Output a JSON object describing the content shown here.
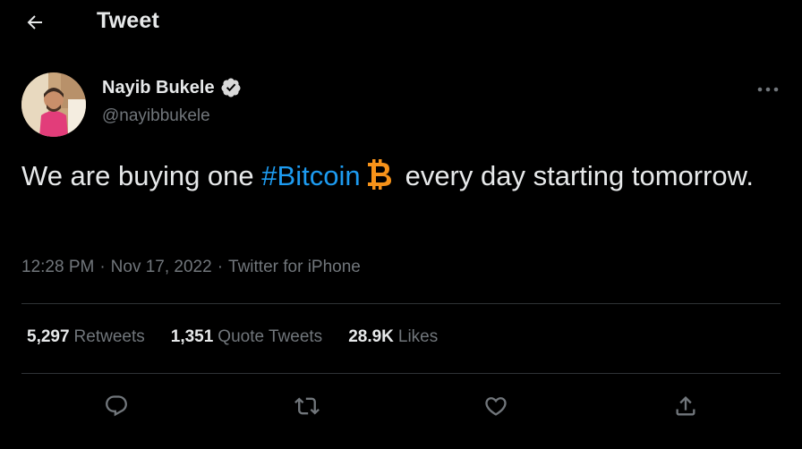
{
  "header": {
    "title": "Tweet",
    "back_icon": "arrow-left-icon"
  },
  "author": {
    "display_name": "Nayib Bukele",
    "handle": "@nayibbukele",
    "verified_icon": "verified-badge-icon",
    "avatar_icon": "avatar"
  },
  "tweet": {
    "text_before": "We are buying one ",
    "hashtag": "#Bitcoin",
    "emoji": "bitcoin-emoji-icon",
    "text_after": "every day starting tomorrow."
  },
  "meta": {
    "time": "12:28 PM",
    "separator": "·",
    "date": "Nov 17, 2022",
    "source": "Twitter for iPhone"
  },
  "stats": [
    {
      "count": "5,297",
      "label": "Retweets"
    },
    {
      "count": "1,351",
      "label": "Quote Tweets"
    },
    {
      "count": "28.9K",
      "label": "Likes"
    }
  ],
  "actions": [
    {
      "icon": "reply-icon"
    },
    {
      "icon": "retweet-icon"
    },
    {
      "icon": "like-icon"
    },
    {
      "icon": "share-icon"
    }
  ],
  "colors": {
    "background": "#000000",
    "text": "#e7e9ea",
    "secondary": "#71767b",
    "accent": "#1d9bf0",
    "bitcoin": "#f7931a",
    "divider": "#2f3336"
  }
}
